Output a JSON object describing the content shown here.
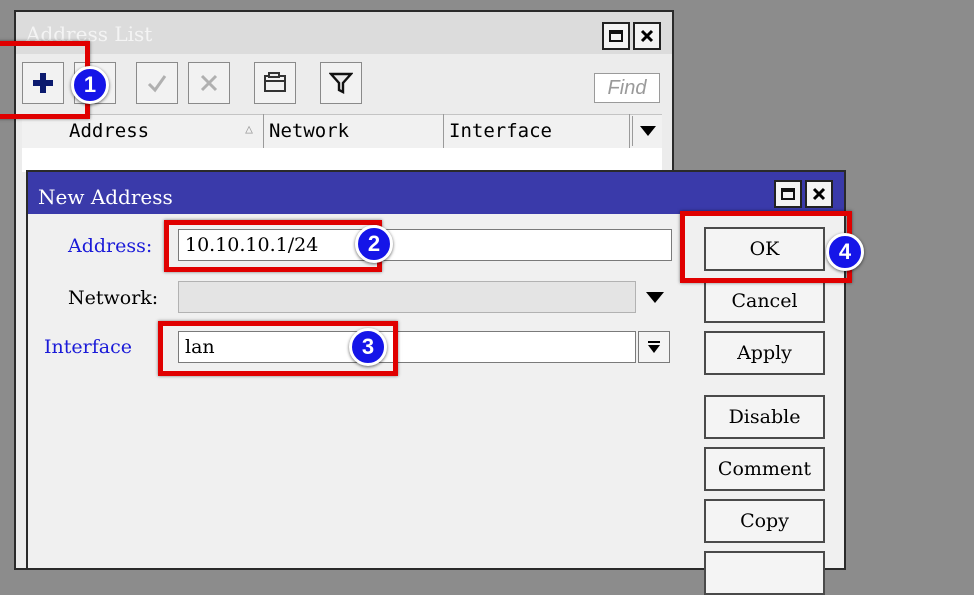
{
  "address_list": {
    "title": "Address List",
    "find_placeholder": "Find",
    "columns": [
      "Address",
      "Network",
      "Interface"
    ]
  },
  "new_address": {
    "title": "New Address",
    "address_label": "Address:",
    "address_value": "10.10.10.1/24",
    "network_label": "Network:",
    "network_value": "",
    "interface_label": "Interface",
    "interface_value": "lan",
    "buttons": [
      "OK",
      "Cancel",
      "Apply",
      "Disable",
      "Comment",
      "Copy"
    ]
  },
  "callouts": [
    "1",
    "2",
    "3",
    "4"
  ],
  "colors": {
    "title_bar_active": "#3a3aaa",
    "label_blue": "#1a1ad8",
    "callout_red": "#e00000",
    "badge_blue": "#1515e8"
  }
}
